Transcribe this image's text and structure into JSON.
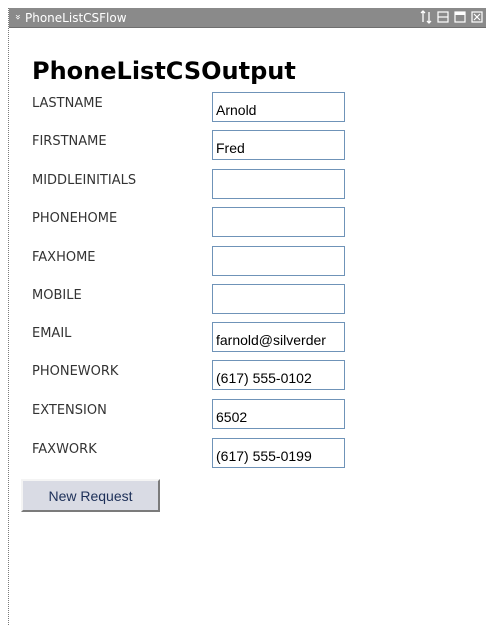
{
  "titlebar": {
    "title": "PhoneListCSFlow",
    "collapse_glyph": "»",
    "controls": [
      "sort-arrows-icon",
      "minimize-icon",
      "maximize-icon",
      "close-icon"
    ]
  },
  "main": {
    "page_title": "PhoneListCSOutput",
    "fields": [
      {
        "label": "LASTNAME",
        "value": "Arnold"
      },
      {
        "label": "FIRSTNAME",
        "value": "Fred"
      },
      {
        "label": "MIDDLEINITIALS",
        "value": ""
      },
      {
        "label": "PHONEHOME",
        "value": ""
      },
      {
        "label": "FAXHOME",
        "value": ""
      },
      {
        "label": "MOBILE",
        "value": ""
      },
      {
        "label": "EMAIL",
        "value": "farnold@silverder"
      },
      {
        "label": "PHONEWORK",
        "value": "(617) 555-0102"
      },
      {
        "label": "EXTENSION",
        "value": "6502"
      },
      {
        "label": "FAXWORK",
        "value": "(617) 555-0199"
      }
    ],
    "new_request_label": "New Request"
  },
  "colors": {
    "titlebar_bg": "#8a8a8a",
    "input_border": "#6f93b8",
    "button_bg": "#d9dbe4",
    "button_text": "#1c2f58"
  }
}
